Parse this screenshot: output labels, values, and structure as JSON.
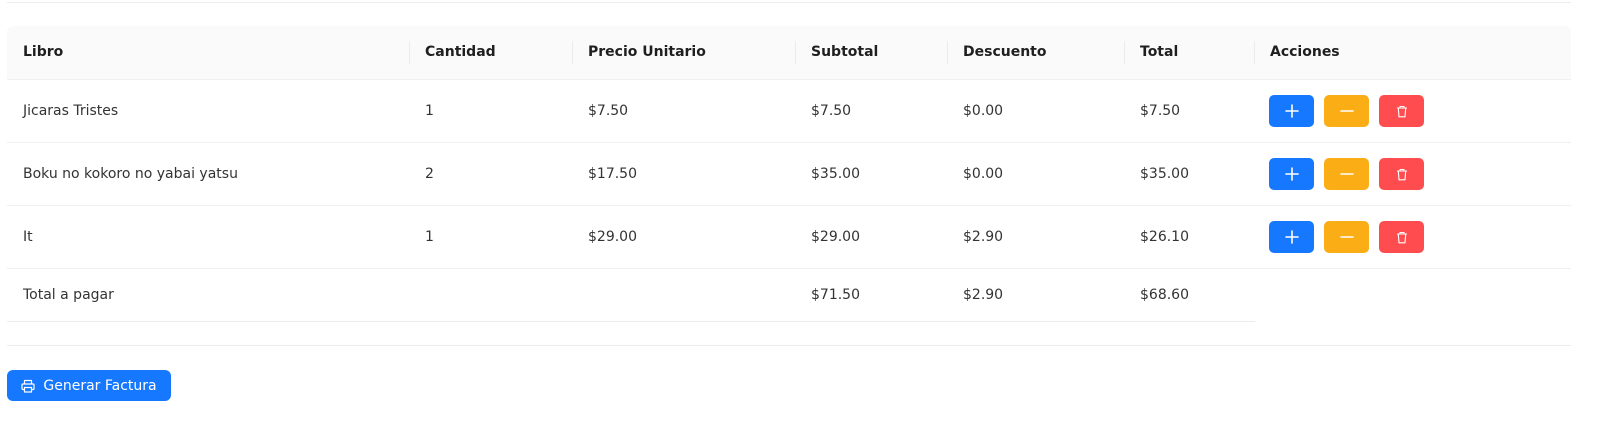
{
  "table": {
    "headers": {
      "book": "Libro",
      "quantity": "Cantidad",
      "unit_price": "Precio Unitario",
      "subtotal": "Subtotal",
      "discount": "Descuento",
      "total": "Total",
      "actions": "Acciones"
    },
    "rows": [
      {
        "book": "Jicaras Tristes",
        "quantity": "1",
        "unit_price": "$7.50",
        "subtotal": "$7.50",
        "discount": "$0.00",
        "total": "$7.50"
      },
      {
        "book": "Boku no kokoro no yabai yatsu",
        "quantity": "2",
        "unit_price": "$17.50",
        "subtotal": "$35.00",
        "discount": "$0.00",
        "total": "$35.00"
      },
      {
        "book": "It",
        "quantity": "1",
        "unit_price": "$29.00",
        "subtotal": "$29.00",
        "discount": "$2.90",
        "total": "$26.10"
      }
    ],
    "summary": {
      "label": "Total a pagar",
      "subtotal": "$71.50",
      "discount": "$2.90",
      "total": "$68.60"
    }
  },
  "actions": {
    "icons": {
      "increase": "plus-icon",
      "decrease": "minus-icon",
      "delete": "trash-icon"
    }
  },
  "footer": {
    "generate_label": "Generar Factura",
    "generate_icon": "printer-icon"
  },
  "colors": {
    "primary": "#1677ff",
    "warning": "#faad14",
    "danger": "#ff4d4f"
  }
}
